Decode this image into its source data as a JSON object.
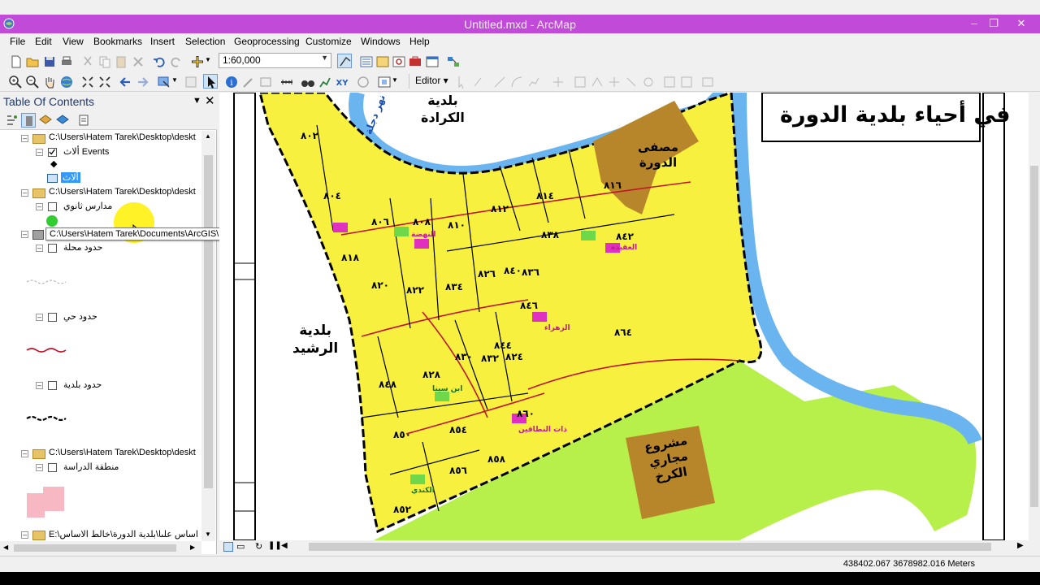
{
  "window": {
    "title": "Untitled.mxd - ArcMap",
    "minimize": "–",
    "restore": "❐",
    "close": "✕"
  },
  "menu": [
    "File",
    "Edit",
    "View",
    "Bookmarks",
    "Insert",
    "Selection",
    "Geoprocessing",
    "Customize",
    "Windows",
    "Help"
  ],
  "toolbar": {
    "scale": "1:60,000",
    "editor_label": "Editor ▾"
  },
  "toc": {
    "title": "Table Of Contents",
    "pin": "▼",
    "close": "✕",
    "tooltip": "C:\\Users\\Hatem Tarek\\Documents\\ArcGIS\\Default.gdb",
    "groups": [
      {
        "path": "C:\\Users\\Hatem Tarek\\Desktop\\deskt",
        "layers": [
          {
            "name": "ألاث Events",
            "checked": true
          },
          {
            "name": "ألاث",
            "table": true,
            "selected": true
          }
        ]
      },
      {
        "path": "C:\\Users\\Hatem Tarek\\Desktop\\deskt",
        "layers": [
          {
            "name": "مدارس ثانوي",
            "checked": false
          }
        ]
      },
      {
        "path": "C:\\Users\\Hatem Tarek\\Documents\\ArcGIS\\Default.gdb",
        "layers": [
          {
            "name": "حدود محلة",
            "checked": false
          },
          {
            "name": "حدود حي",
            "checked": false
          },
          {
            "name": "حدود بلدية",
            "checked": false
          }
        ]
      },
      {
        "path": "C:\\Users\\Hatem Tarek\\Desktop\\deskt",
        "layers": [
          {
            "name": "منطقة الدراسة",
            "checked": false
          }
        ]
      },
      {
        "path": "E:\\اساس علىا\\بلدية الدورة\\خالط الاساس",
        "layers": []
      }
    ]
  },
  "map": {
    "title": "في أحياء بلدية الدورة",
    "labels": {
      "karada": "بلدية\nالكرادة",
      "rashid": "بلدية\nالرشيد",
      "refinery": "مصفى\nالدورة",
      "sewage": "مشروع\nمجاري\nالكرخ",
      "river": "نهر دجلة"
    },
    "mahallas": [
      "٨٠٢",
      "٨٠٤",
      "٨٠٦",
      "٨٠٨",
      "٨١٠",
      "٨١٢",
      "٨١٤",
      "٨١٦",
      "٨١٨",
      "٨٢٠",
      "٨٢٢",
      "٨٢٤",
      "٨٢٦",
      "٨٢٨",
      "٨٣٠",
      "٨٣٢",
      "٨٣٤",
      "٨٣٦",
      "٨٣٨",
      "٨٤٠",
      "٨٤٢",
      "٨٤٤",
      "٨٤٦",
      "٨٤٨",
      "٨٥٠",
      "٨٥٢",
      "٨٥٤",
      "٨٥٦",
      "٨٥٨",
      "٨٦٠",
      "٨٦٤"
    ],
    "schools": [
      "ابن سينا",
      "العقيدة",
      "الزهراء",
      "ذات النطاقين",
      "النهضة",
      "الكندي"
    ]
  },
  "status": {
    "coords": "438402.067  3678982.016 Meters"
  },
  "colors": {
    "title_bar": "#c24ad8",
    "residential": "#f7f03e",
    "green_area": "#b7f04a",
    "river": "#6ab4ef",
    "refinery": "#b8862a",
    "boundary_red": "#c0142a"
  }
}
